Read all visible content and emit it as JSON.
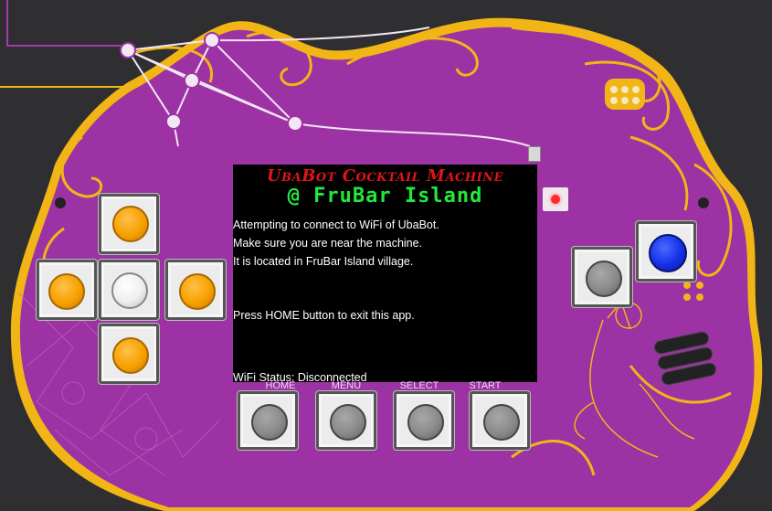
{
  "screen": {
    "title_line1": "UbaBot Cocktail Machine",
    "title_line2": "@ FruBar Island",
    "messages": [
      "Attempting to connect to WiFi of UbaBot.",
      "Make sure you are near the machine.",
      "It is located in FruBar Island village.",
      "Press HOME button to exit this app."
    ],
    "status": "WiFi Status: Disconnected"
  },
  "buttons": {
    "home": "HOME",
    "menu": "MENU",
    "select": "SELECT",
    "start": "START"
  },
  "dpad": [
    "up",
    "left",
    "center",
    "right",
    "down"
  ],
  "colors": {
    "board": "#9c32a4",
    "gold": "#f2b516",
    "screen": "#000000",
    "title_red": "#e0141b",
    "title_green": "#22e83e",
    "dpad_orange": "#f7a100",
    "blue_button": "#1430e8"
  }
}
